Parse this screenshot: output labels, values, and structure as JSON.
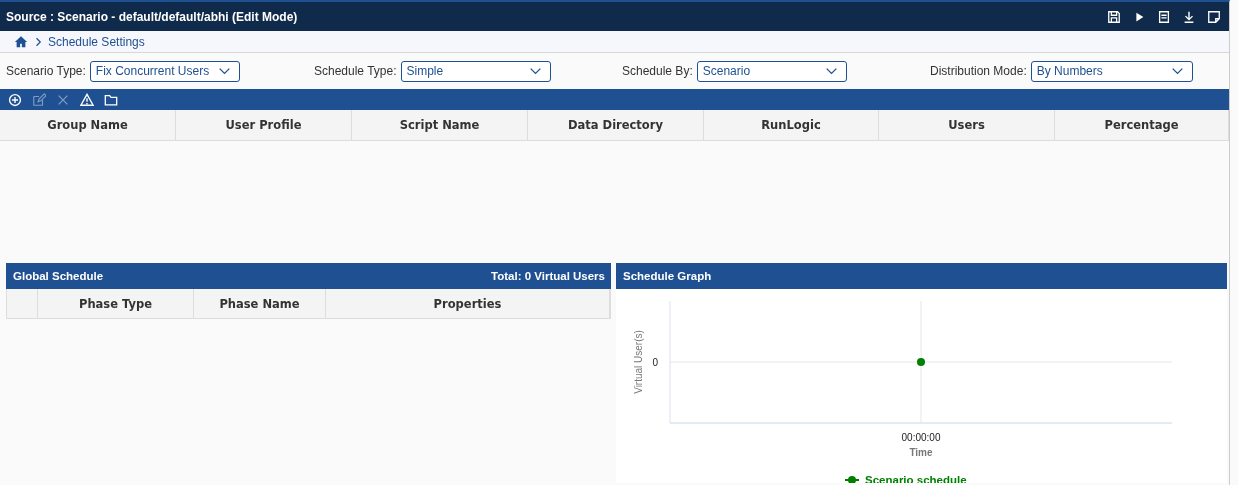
{
  "window": {
    "title": "Source : Scenario - default/default/abhi (Edit Mode)"
  },
  "header_actions": [
    {
      "kind": "save"
    },
    {
      "kind": "play"
    },
    {
      "kind": "list"
    },
    {
      "kind": "download"
    },
    {
      "kind": "note"
    }
  ],
  "breadcrumb": [
    {
      "label": "Schedule Settings"
    }
  ],
  "filters": [
    {
      "label": "Scenario Type:",
      "value": "Fix Concurrent Users"
    },
    {
      "label": "Schedule Type:",
      "value": "Simple"
    },
    {
      "label": "Schedule By:",
      "value": "Scenario"
    },
    {
      "label": "Distribution Mode:",
      "value": "By Numbers"
    }
  ],
  "toolbar": [
    {
      "kind": "add",
      "disabled": false
    },
    {
      "kind": "edit",
      "disabled": true
    },
    {
      "kind": "delete",
      "disabled": true
    },
    {
      "kind": "warning",
      "disabled": false
    },
    {
      "kind": "folder",
      "disabled": false
    }
  ],
  "groups_table": {
    "columns": [
      "Group Name",
      "User Profile",
      "Script Name",
      "Data Directory",
      "RunLogic",
      "Users",
      "Percentage"
    ]
  },
  "global_schedule": {
    "title": "Global Schedule",
    "total": "Total: 0 Virtual Users",
    "columns": [
      "",
      "Phase Type",
      "Phase Name",
      "Properties"
    ]
  },
  "schedule_graph": {
    "title": "Schedule Graph",
    "y_axis_title": "Virtual User(s)",
    "y_tick": "0",
    "x_tick": "00:00:00",
    "x_axis_title": "Time",
    "legend": "Scenario schedule"
  }
}
